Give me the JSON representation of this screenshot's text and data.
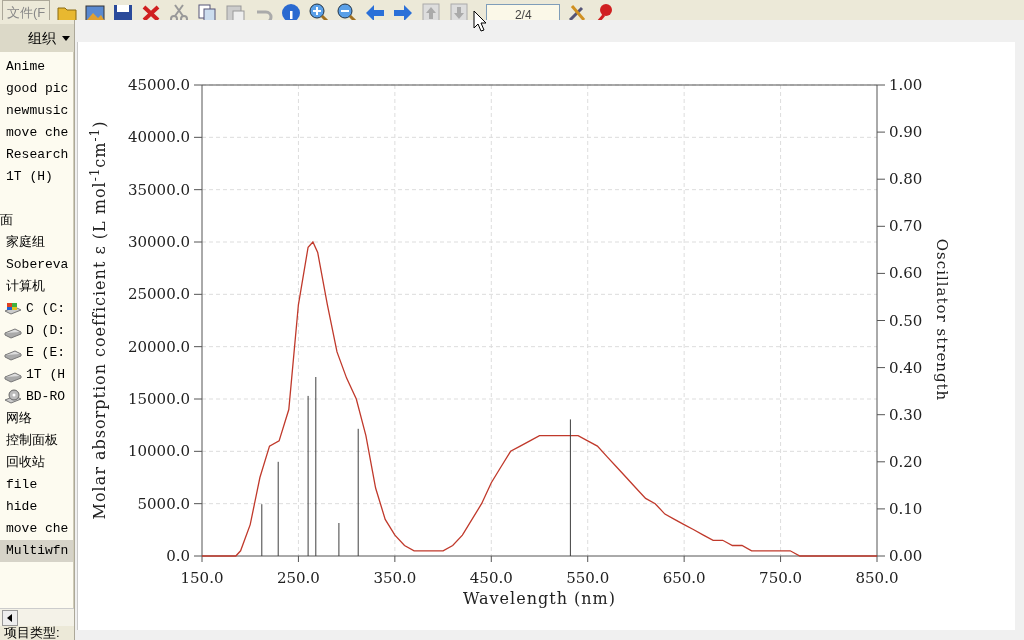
{
  "toolbar": {
    "menu_label": "文件(F",
    "page_field": "2/4"
  },
  "sidebar": {
    "header": "组织",
    "items": [
      {
        "label": "Anime",
        "kind": "text",
        "selected": false
      },
      {
        "label": "good pic",
        "kind": "text",
        "selected": false
      },
      {
        "label": "newmusic",
        "kind": "text",
        "selected": false
      },
      {
        "label": "move che",
        "kind": "text",
        "selected": false
      },
      {
        "label": "Research",
        "kind": "text",
        "selected": false
      },
      {
        "label": "1T (H)",
        "kind": "text",
        "selected": false
      },
      {
        "label": "面",
        "kind": "gap-text",
        "selected": false
      },
      {
        "label": "家庭组",
        "kind": "text",
        "selected": false
      },
      {
        "label": "Sobereva",
        "kind": "text",
        "selected": false
      },
      {
        "label": "计算机",
        "kind": "text",
        "selected": false
      },
      {
        "label": "C (C:",
        "kind": "system-drive",
        "selected": false
      },
      {
        "label": "D (D:",
        "kind": "drive",
        "selected": false
      },
      {
        "label": "E (E:",
        "kind": "drive",
        "selected": false
      },
      {
        "label": "1T (H",
        "kind": "drive",
        "selected": false
      },
      {
        "label": "BD-RO",
        "kind": "disc",
        "selected": false
      },
      {
        "label": "网络",
        "kind": "text",
        "selected": false
      },
      {
        "label": "控制面板",
        "kind": "text",
        "selected": false
      },
      {
        "label": "回收站",
        "kind": "text",
        "selected": false
      },
      {
        "label": "file",
        "kind": "text",
        "selected": false
      },
      {
        "label": "hide",
        "kind": "text",
        "selected": false
      },
      {
        "label": "move che",
        "kind": "text",
        "selected": false
      },
      {
        "label": "Multiwfn",
        "kind": "text",
        "selected": true
      }
    ],
    "footer": "项目类型:"
  },
  "spectrum": {
    "chart_data": {
      "type": "line",
      "xlabel": "Wavelength (nm)",
      "ylabel": "Molar absorption coefficient  ε (L mol$^{-1}$cm$^{-1}$)",
      "grid": true,
      "xlim": [
        150,
        850
      ],
      "ylim": [
        0,
        45000
      ],
      "xticks": [
        {
          "value": 150,
          "label": "150.0"
        },
        {
          "value": 250,
          "label": "250.0"
        },
        {
          "value": 350,
          "label": "350.0"
        },
        {
          "value": 450,
          "label": "450.0"
        },
        {
          "value": 550,
          "label": "550.0"
        },
        {
          "value": 650,
          "label": "650.0"
        },
        {
          "value": 750,
          "label": "750.0"
        },
        {
          "value": 850,
          "label": "850.0"
        }
      ],
      "yticks": [
        {
          "value": 0,
          "label": "0.0"
        },
        {
          "value": 5000,
          "label": "5000.0"
        },
        {
          "value": 10000,
          "label": "10000.0"
        },
        {
          "value": 15000,
          "label": "15000.0"
        },
        {
          "value": 20000,
          "label": "20000.0"
        },
        {
          "value": 25000,
          "label": "25000.0"
        },
        {
          "value": 30000,
          "label": "30000.0"
        },
        {
          "value": 35000,
          "label": "35000.0"
        },
        {
          "value": 40000,
          "label": "40000.0"
        },
        {
          "value": 45000,
          "label": "45000.0"
        }
      ],
      "x": [
        150,
        160,
        170,
        180,
        185,
        190,
        200,
        210,
        220,
        230,
        240,
        250,
        260,
        265,
        270,
        280,
        290,
        300,
        310,
        320,
        330,
        340,
        350,
        360,
        370,
        380,
        390,
        400,
        410,
        420,
        430,
        440,
        450,
        460,
        470,
        480,
        490,
        500,
        510,
        520,
        530,
        540,
        550,
        560,
        570,
        580,
        590,
        600,
        610,
        620,
        630,
        640,
        650,
        660,
        670,
        680,
        690,
        700,
        710,
        720,
        730,
        740,
        750,
        760,
        770,
        780,
        790,
        800,
        810,
        820,
        830,
        840,
        850
      ],
      "series": [
        {
          "color": "#c0392b",
          "values": [
            0,
            0,
            0,
            0,
            0,
            500,
            3000,
            7500,
            10500,
            11000,
            14000,
            24000,
            29500,
            30000,
            29000,
            24000,
            19500,
            17000,
            15000,
            11500,
            6500,
            3500,
            2000,
            1000,
            500,
            500,
            500,
            500,
            1000,
            2000,
            3500,
            5000,
            7000,
            8500,
            10000,
            10500,
            11000,
            11500,
            11500,
            11500,
            11500,
            11500,
            11000,
            10500,
            9500,
            8500,
            7500,
            6500,
            5500,
            5000,
            4000,
            3500,
            3000,
            2500,
            2000,
            1500,
            1500,
            1000,
            1000,
            500,
            500,
            500,
            500,
            500,
            0,
            0,
            0,
            0,
            0,
            0,
            0,
            0,
            0
          ]
        }
      ]
    }
  },
  "oscillator_strengths": {
    "chart_data": {
      "type": "bar",
      "ylabel": "Oscillator strength",
      "xlim": [
        150,
        850
      ],
      "ylim": [
        0,
        1
      ],
      "yticks": [
        {
          "value": 0,
          "label": "0.00"
        },
        {
          "value": 0.1,
          "label": "0.10"
        },
        {
          "value": 0.2,
          "label": "0.20"
        },
        {
          "value": 0.3,
          "label": "0.30"
        },
        {
          "value": 0.4,
          "label": "0.40"
        },
        {
          "value": 0.5,
          "label": "0.50"
        },
        {
          "value": 0.6,
          "label": "0.60"
        },
        {
          "value": 0.7,
          "label": "0.70"
        },
        {
          "value": 0.8,
          "label": "0.80"
        },
        {
          "value": 0.9,
          "label": "0.90"
        },
        {
          "value": 1,
          "label": "1.00"
        }
      ],
      "x": [
        212,
        229,
        260,
        268,
        292,
        312,
        532
      ],
      "series": [
        {
          "color": "#404040",
          "values": [
            0.11,
            0.2,
            0.34,
            0.38,
            0.07,
            0.27,
            0.29
          ]
        }
      ]
    }
  }
}
